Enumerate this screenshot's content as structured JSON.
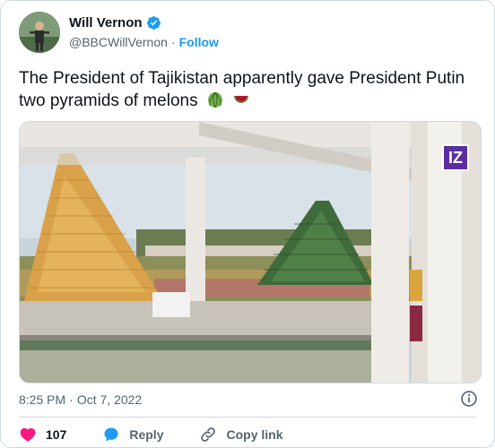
{
  "author": {
    "name": "Will Vernon",
    "handle": "@BBCWillVernon",
    "separator": "·",
    "follow_label": "Follow"
  },
  "tweet": {
    "text": "The President of Tajikistan apparently gave President Putin two pyramids of melons",
    "emojis": [
      "melon-emoji",
      "watermelon-emoji"
    ]
  },
  "media": {
    "watermark_text": "IZ"
  },
  "meta": {
    "time": "8:25 PM",
    "separator": "·",
    "date": "Oct 7, 2022"
  },
  "actions": {
    "like_count": "107",
    "reply_label": "Reply",
    "copy_link_label": "Copy link"
  },
  "colors": {
    "accent": "#1d9bf0",
    "like": "#f91880",
    "iz_brand": "#5b2fa0"
  }
}
